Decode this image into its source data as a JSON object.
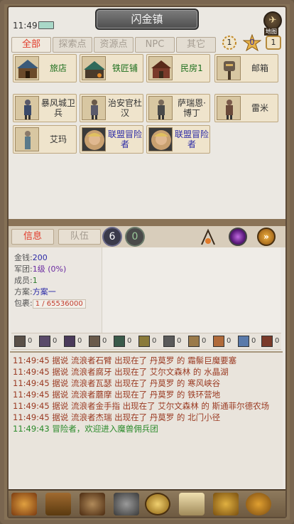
{
  "status": {
    "time": "11:49"
  },
  "header": {
    "title": "闪金镇",
    "map_label": "地图"
  },
  "filters": {
    "tabs": [
      "全部",
      "探索点",
      "资源点",
      "NPC",
      "其它"
    ],
    "counters": [
      "1",
      "0",
      "1"
    ]
  },
  "locations": [
    {
      "label": "旅店",
      "type": "shop",
      "icon": "inn-icon"
    },
    {
      "label": "铁匠铺",
      "type": "shop",
      "icon": "blacksmith-icon"
    },
    {
      "label": "民房1",
      "type": "shop",
      "icon": "house-icon"
    },
    {
      "label": "邮箱",
      "type": "normal",
      "icon": "mailbox-icon"
    },
    {
      "label": "暴风城卫兵",
      "type": "normal",
      "icon": "guard-icon"
    },
    {
      "label": "治安官杜汉",
      "type": "normal",
      "icon": "sheriff-icon"
    },
    {
      "label": "萨瑞恩·博丁",
      "type": "normal",
      "icon": "npc-icon"
    },
    {
      "label": "雷米",
      "type": "normal",
      "icon": "npc-icon"
    },
    {
      "label": "艾玛",
      "type": "normal",
      "icon": "npc-icon"
    },
    {
      "label": "联盟冒险者",
      "type": "blue",
      "icon": "adventurer-portrait-icon"
    },
    {
      "label": "联盟冒险者",
      "type": "blue",
      "icon": "adventurer-portrait-icon"
    }
  ],
  "panel_tabs": {
    "info": "信息",
    "team": "队伍",
    "count_a": "6",
    "count_b": "0"
  },
  "info": {
    "gold_label": "金钱:",
    "gold": "200",
    "legion_label": "军团:",
    "legion": "1级 (0%)",
    "members_label": "成员:",
    "members": "1",
    "plan_label": "方案:",
    "plan": "方案一",
    "bag_label": "包裹:",
    "bag": "1 / 65536000"
  },
  "items": [
    "0",
    "0",
    "0",
    "0",
    "0",
    "0",
    "0",
    "0",
    "0",
    "0",
    "0"
  ],
  "log": [
    {
      "time": "11:49:45",
      "text": "据说 流浪者石臂 出现在了 丹莫罗 的 霜鬃巨魔要塞",
      "color": "red"
    },
    {
      "time": "11:49:45",
      "text": "据说 流浪者腐牙 出现在了 艾尔文森林 的 水晶湖",
      "color": "red"
    },
    {
      "time": "11:49:45",
      "text": "据说 流浪者瓦瑟 出现在了 丹莫罗 的 寒风峡谷",
      "color": "red"
    },
    {
      "time": "11:49:45",
      "text": "据说 流浪者蘑摩 出现在了 丹莫罗 的 铁环营地",
      "color": "red"
    },
    {
      "time": "11:49:45",
      "text": "据说 流浪者金手指 出现在了 艾尔文森林 的 斯通菲尔德农场",
      "color": "red"
    },
    {
      "time": "11:49:45",
      "text": "据说 流浪者杰瑞 出现在了 丹莫罗 的 北门小径",
      "color": "red"
    },
    {
      "time": "11:49:43",
      "text": "冒险者，欢迎进入魔兽佣兵团",
      "color": "green"
    }
  ],
  "bottom_nav": [
    "hero-icon",
    "chest-icon",
    "warrior-icon",
    "knight-icon",
    "alliance-emblem-icon",
    "scroll-icon",
    "trophy-icon",
    "settings-gear-icon"
  ],
  "colors": {
    "accent_red": "#e23a2a",
    "blue_text": "#2b2aa6",
    "log_red": "#9a3a22",
    "log_green": "#2a8a2a"
  }
}
